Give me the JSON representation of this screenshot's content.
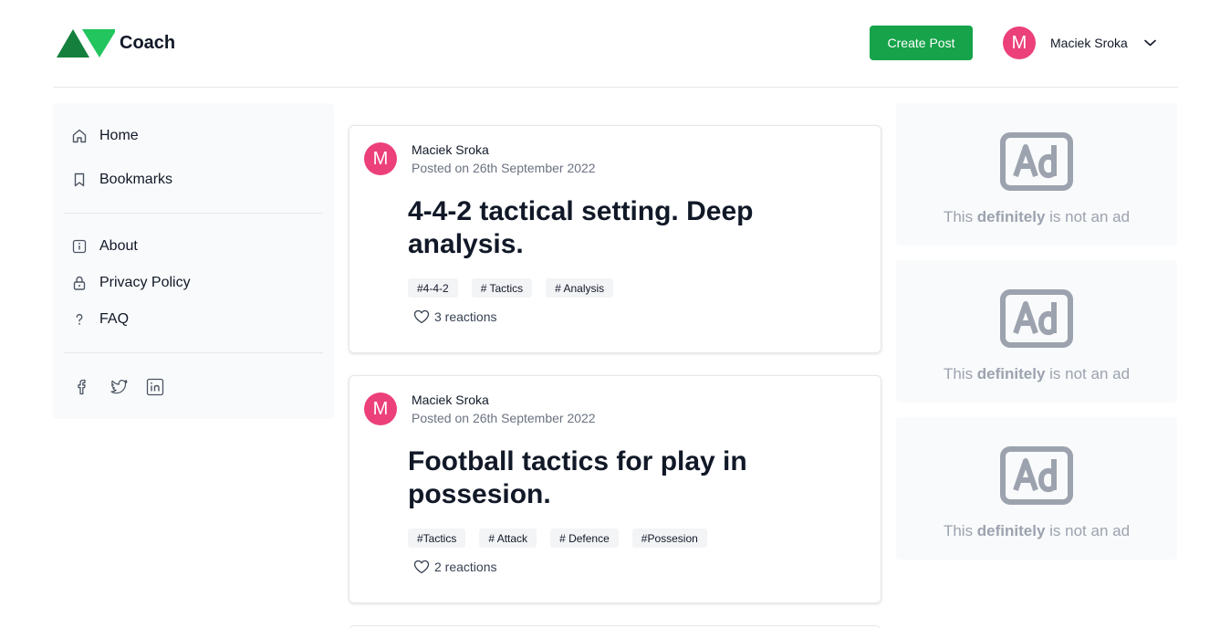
{
  "brand": {
    "name": "Coach"
  },
  "header": {
    "create_post": "Create Post",
    "user": {
      "initial": "M",
      "name": "Maciek Sroka"
    }
  },
  "sidebar": {
    "nav": [
      {
        "label": "Home",
        "icon": "home-icon"
      },
      {
        "label": "Bookmarks",
        "icon": "bookmark-icon"
      }
    ],
    "links": [
      {
        "label": "About",
        "icon": "info-icon"
      },
      {
        "label": "Privacy Policy",
        "icon": "lock-icon"
      },
      {
        "label": "FAQ",
        "icon": "question-icon"
      }
    ],
    "social": [
      "facebook-icon",
      "twitter-icon",
      "linkedin-icon"
    ]
  },
  "posts": [
    {
      "author_initial": "M",
      "author": "Maciek Sroka",
      "date": "Posted on 26th September 2022",
      "title": "4-4-2 tactical setting. Deep analysis.",
      "tags": [
        "#4-4-2",
        "# Tactics",
        "# Analysis"
      ],
      "reactions": "3 reactions"
    },
    {
      "author_initial": "M",
      "author": "Maciek Sroka",
      "date": "Posted on 26th September 2022",
      "title": "Football tactics for play in possesion.",
      "tags": [
        "#Tactics",
        "# Attack",
        "# Defence",
        "#Possesion"
      ],
      "reactions": "2 reactions"
    }
  ],
  "ads": [
    {
      "prefix": "This ",
      "emphasis": "definitely",
      "suffix": " is not an ad"
    },
    {
      "prefix": "This ",
      "emphasis": "definitely",
      "suffix": " is not an ad"
    },
    {
      "prefix": "This ",
      "emphasis": "definitely",
      "suffix": " is not an ad"
    }
  ],
  "colors": {
    "accent": "#16a34a",
    "avatar": "#ec407a",
    "logo_dark": "#15803d",
    "logo_light": "#22c55e"
  }
}
